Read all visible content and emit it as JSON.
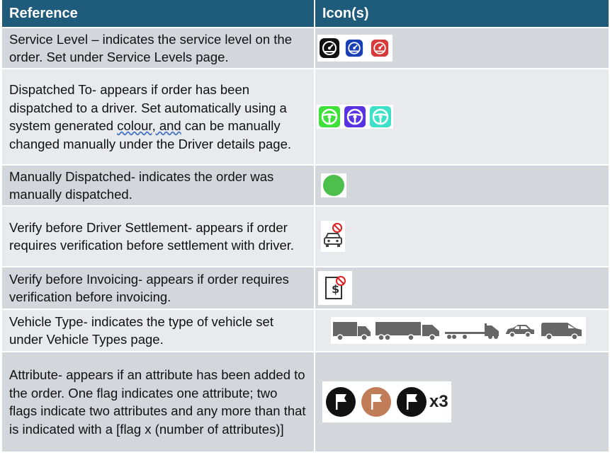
{
  "header": {
    "col_reference": "Reference",
    "col_icons": "Icon(s)"
  },
  "rows": [
    {
      "text": "Service Level – indicates the service level on the order. Set under Service Levels page.",
      "icons": [
        "speedometer-black-icon",
        "speedometer-blue-icon",
        "speedometer-red-icon"
      ]
    },
    {
      "text_before": "Dispatched To- appears if order has been dispatched to a driver. Set automatically using a system generated ",
      "text_underlined": "colour, and",
      "text_after": " can be manually changed manually under the Driver details page.",
      "icons": [
        "steering-wheel-green-icon",
        "steering-wheel-purple-icon",
        "steering-wheel-teal-icon"
      ]
    },
    {
      "text": "Manually Dispatched- indicates the order was manually dispatched.",
      "icons": [
        "green-dot-icon"
      ]
    },
    {
      "text": "Verify before Driver Settlement- appears if order requires verification before settlement with driver.",
      "icons": [
        "car-prohibited-icon"
      ]
    },
    {
      "text": "Verify before Invoicing- appears if order requires verification before invoicing.",
      "icons": [
        "invoice-prohibited-icon"
      ]
    },
    {
      "text": "Vehicle Type- indicates the type of vehicle set under Vehicle Types page.",
      "icons": [
        "box-truck-icon",
        "semi-truck-icon",
        "flatbed-truck-icon",
        "car-icon",
        "van-icon"
      ]
    },
    {
      "text": "Attribute- appears if an attribute has been added to the order. One flag indicates one attribute; two flags indicate two attributes and any more than that is indicated with a [flag x (number of attributes)]",
      "icons": [
        "flag-black-icon",
        "flag-brown-icon",
        "flag-black-icon"
      ],
      "count_label": "x3"
    }
  ],
  "colors": {
    "header_bg": "#1f5b7a",
    "speedometer_blue": "#1a3fb5",
    "speedometer_red": "#d63a3a",
    "wheel_green": "#3fe03a",
    "wheel_purple": "#5a33e0",
    "wheel_teal": "#3fe0c8",
    "dot_green": "#4cbf4c",
    "flag_brown": "#c07d58"
  }
}
